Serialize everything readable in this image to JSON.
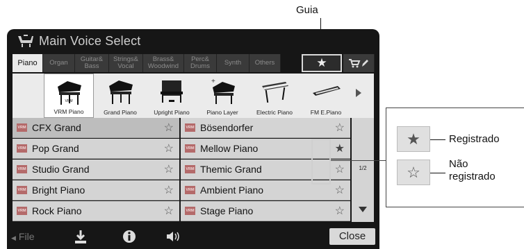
{
  "callouts": {
    "guia": "Guia"
  },
  "window": {
    "title": "Main Voice Select"
  },
  "tabs": [
    {
      "label": "Piano"
    },
    {
      "label": "Organ"
    },
    {
      "label": "Guitar& Bass"
    },
    {
      "label": "Strings& Vocal"
    },
    {
      "label": "Brass& Woodwind"
    },
    {
      "label": "Perc& Drums"
    },
    {
      "label": "Synth"
    },
    {
      "label": "Others"
    },
    {
      "label": "★"
    }
  ],
  "instruments": [
    {
      "label": "VRM Piano",
      "badge": "VRM"
    },
    {
      "label": "Grand Piano"
    },
    {
      "label": "Upright Piano"
    },
    {
      "label": "Piano Layer"
    },
    {
      "label": "Electric Piano"
    },
    {
      "label": "FM E.Piano"
    }
  ],
  "voices_left": [
    {
      "badge": "VRM",
      "name": "CFX Grand",
      "star": "☆"
    },
    {
      "badge": "VRM",
      "name": "Pop Grand",
      "star": "☆"
    },
    {
      "badge": "VRM",
      "name": "Studio Grand",
      "star": "☆"
    },
    {
      "badge": "VRM",
      "name": "Bright Piano",
      "star": "☆"
    },
    {
      "badge": "VRM",
      "name": "Rock Piano",
      "star": "☆"
    }
  ],
  "voices_right": [
    {
      "badge": "VRM",
      "name": "Bösendorfer",
      "star": "☆"
    },
    {
      "badge": "VRM",
      "name": "Mellow Piano",
      "star": "★"
    },
    {
      "badge": "VRM",
      "name": "Themic Grand",
      "star": "☆"
    },
    {
      "badge": "VRM",
      "name": "Ambient Piano",
      "star": "☆"
    },
    {
      "badge": "VRM",
      "name": "Stage Piano",
      "star": "☆"
    }
  ],
  "pagination": {
    "page": "1/2"
  },
  "bottom": {
    "file": "File",
    "close": "Close"
  },
  "legend": {
    "registered_star": "★",
    "registered_label": "Registrado",
    "unregistered_star": "☆",
    "unregistered_label_line1": "Não",
    "unregistered_label_line2": "registrado"
  },
  "icons": [
    "keyboard-logo-icon",
    "cart-icon",
    "edit-icon",
    "chevron-right-icon",
    "chevron-down-icon",
    "download-icon",
    "info-icon",
    "speaker-icon",
    "star-icon"
  ],
  "colors": {
    "screen_bg": "#161616",
    "tab_active": "#eaeaea",
    "row_bg": "#d4d4d4",
    "vrm_badge": "#b46a6a"
  }
}
